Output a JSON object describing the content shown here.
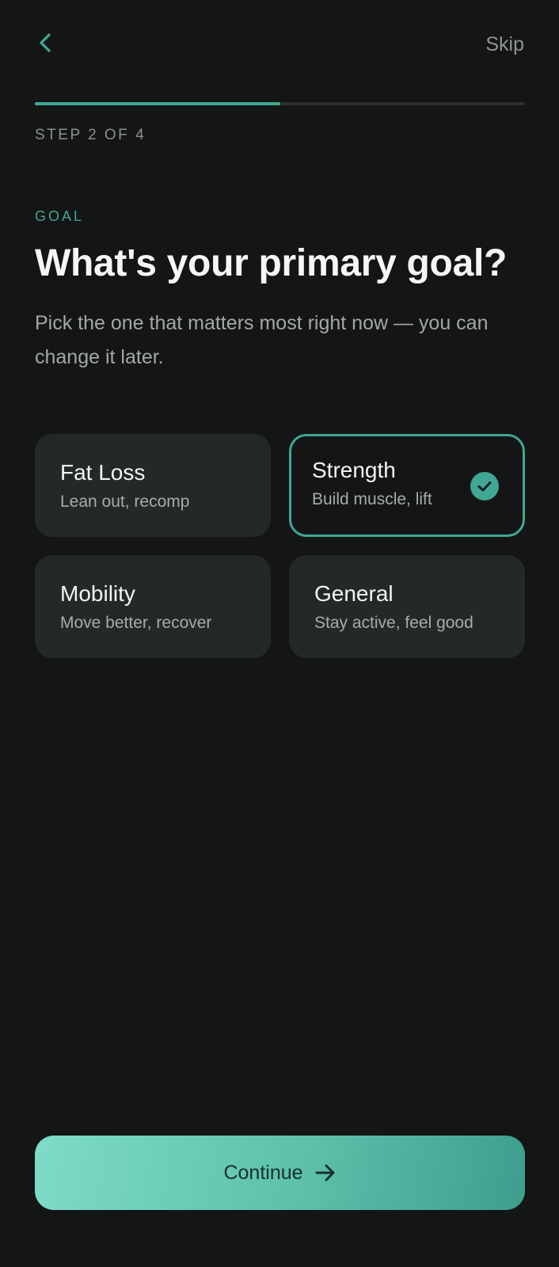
{
  "header": {
    "back_icon": "chevron-left-icon",
    "skip_label": "Skip"
  },
  "progress": {
    "step_label": "STEP 2 OF 4",
    "current_step": 2,
    "total_steps": 4,
    "fraction": 0.5
  },
  "intro": {
    "eyebrow": "GOAL",
    "title": "What's your primary goal?",
    "subtitle": "Pick the one that matters most right now — you can change it later."
  },
  "goals": [
    {
      "title": "Fat Loss",
      "subtitle": "Lean out, recomp",
      "selected": false
    },
    {
      "title": "Strength",
      "subtitle": "Build muscle, lift",
      "selected": true
    },
    {
      "title": "Mobility",
      "subtitle": "Move better, recover",
      "selected": false
    },
    {
      "title": "General",
      "subtitle": "Stay active, feel good",
      "selected": false
    }
  ],
  "footer": {
    "continue_label": "Continue",
    "continue_icon": "arrow-right-icon"
  },
  "colors": {
    "background": "#141515",
    "accent": "#3fa794",
    "card": "#242828",
    "button_gradient_start": "#7edcc7",
    "button_gradient_end": "#3d9e8d"
  }
}
